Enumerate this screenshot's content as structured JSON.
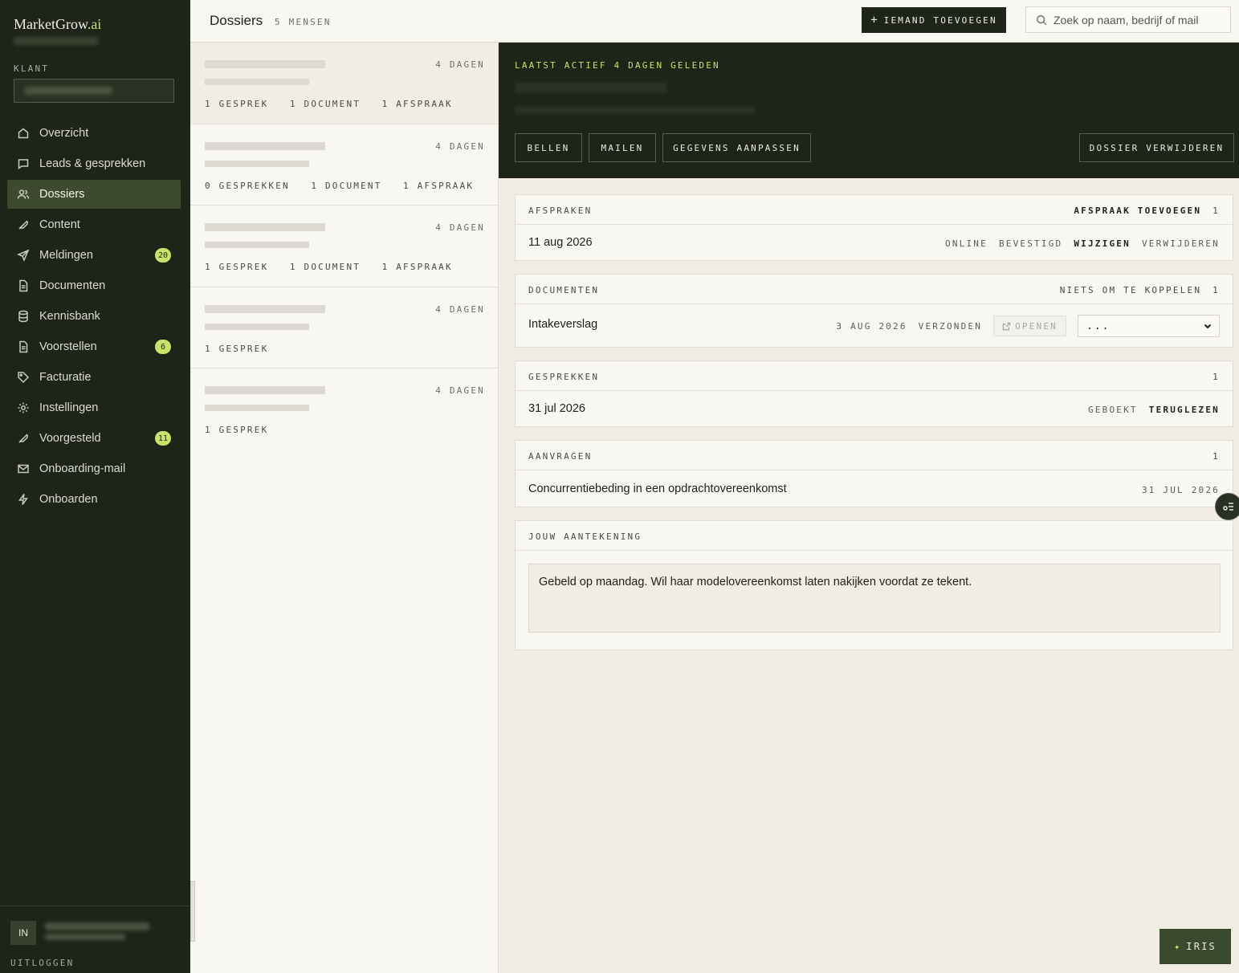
{
  "app": {
    "logo_main": "MarketGrow",
    "logo_suffix": ".ai"
  },
  "sidebar": {
    "klant_label": "KLANT",
    "items": [
      {
        "label": "Overzicht",
        "icon": "home-icon"
      },
      {
        "label": "Leads & gesprekken",
        "icon": "chat-icon"
      },
      {
        "label": "Dossiers",
        "icon": "users-icon",
        "active": true
      },
      {
        "label": "Content",
        "icon": "feather-icon"
      },
      {
        "label": "Meldingen",
        "icon": "send-icon",
        "badge": "20"
      },
      {
        "label": "Documenten",
        "icon": "document-icon"
      },
      {
        "label": "Kennisbank",
        "icon": "database-icon"
      },
      {
        "label": "Voorstellen",
        "icon": "document-icon",
        "badge": "6"
      },
      {
        "label": "Facturatie",
        "icon": "tag-icon"
      },
      {
        "label": "Instellingen",
        "icon": "gear-icon"
      },
      {
        "label": "Voorgesteld",
        "icon": "feather-icon",
        "badge": "11"
      },
      {
        "label": "Onboarding-mail",
        "icon": "mail-icon"
      },
      {
        "label": "Onboarden",
        "icon": "bolt-icon"
      }
    ],
    "user_initials": "IN",
    "logout": "UITLOGGEN"
  },
  "header": {
    "title": "Dossiers",
    "count": "5 MENSEN",
    "add_button": "IEMAND TOEVOEGEN",
    "search_placeholder": "Zoek op naam, bedrijf of mail"
  },
  "list": [
    {
      "time": "4 DAGEN",
      "stats": "1 GESPREK   1 DOCUMENT   1 AFSPRAAK"
    },
    {
      "time": "4 DAGEN",
      "stats": "0 GESPREKKEN   1 DOCUMENT   1 AFSPRAAK"
    },
    {
      "time": "4 DAGEN",
      "stats": "1 GESPREK   1 DOCUMENT   1 AFSPRAAK"
    },
    {
      "time": "4 DAGEN",
      "stats": "1 GESPREK"
    },
    {
      "time": "4 DAGEN",
      "stats": "1 GESPREK"
    }
  ],
  "detail": {
    "status": "LAATST ACTIEF 4 DAGEN GELEDEN",
    "buttons": {
      "call": "BELLEN",
      "mail": "MAILEN",
      "edit": "GEGEVENS AANPASSEN",
      "delete": "DOSSIER VERWIJDEREN"
    },
    "afspraken": {
      "title": "AFSPRAKEN",
      "action": "AFSPRAAK TOEVOEGEN",
      "count": "1",
      "row": {
        "date": "11 aug 2026",
        "mode": "ONLINE",
        "state": "BEVESTIGD",
        "edit": "WIJZIGEN",
        "remove": "VERWIJDEREN"
      }
    },
    "documenten": {
      "title": "DOCUMENTEN",
      "action": "NIETS OM TE KOPPELEN",
      "count": "1",
      "row": {
        "name": "Intakeverslag",
        "date": "3 AUG 2026",
        "state": "VERZONDEN",
        "open": "OPENEN",
        "select": "..."
      }
    },
    "gesprekken": {
      "title": "GESPREKKEN",
      "count": "1",
      "row": {
        "date": "31 jul 2026",
        "state": "GEBOEKT",
        "action": "TERUGLEZEN"
      }
    },
    "aanvragen": {
      "title": "AANVRAGEN",
      "count": "1",
      "row": {
        "subject": "Concurrentiebeding in een opdrachtovereenkomst",
        "date": "31 JUL 2026"
      }
    },
    "note": {
      "title": "JOUW AANTEKENING",
      "text": "Gebeld op maandag. Wil haar modelovereenkomst laten nakijken voordat ze tekent."
    }
  },
  "assistant": {
    "label": "IRIS"
  },
  "colors": {
    "sidebar_bg": "#1f2419",
    "accent": "#c8e26a",
    "page_bg": "#f1ede4"
  }
}
